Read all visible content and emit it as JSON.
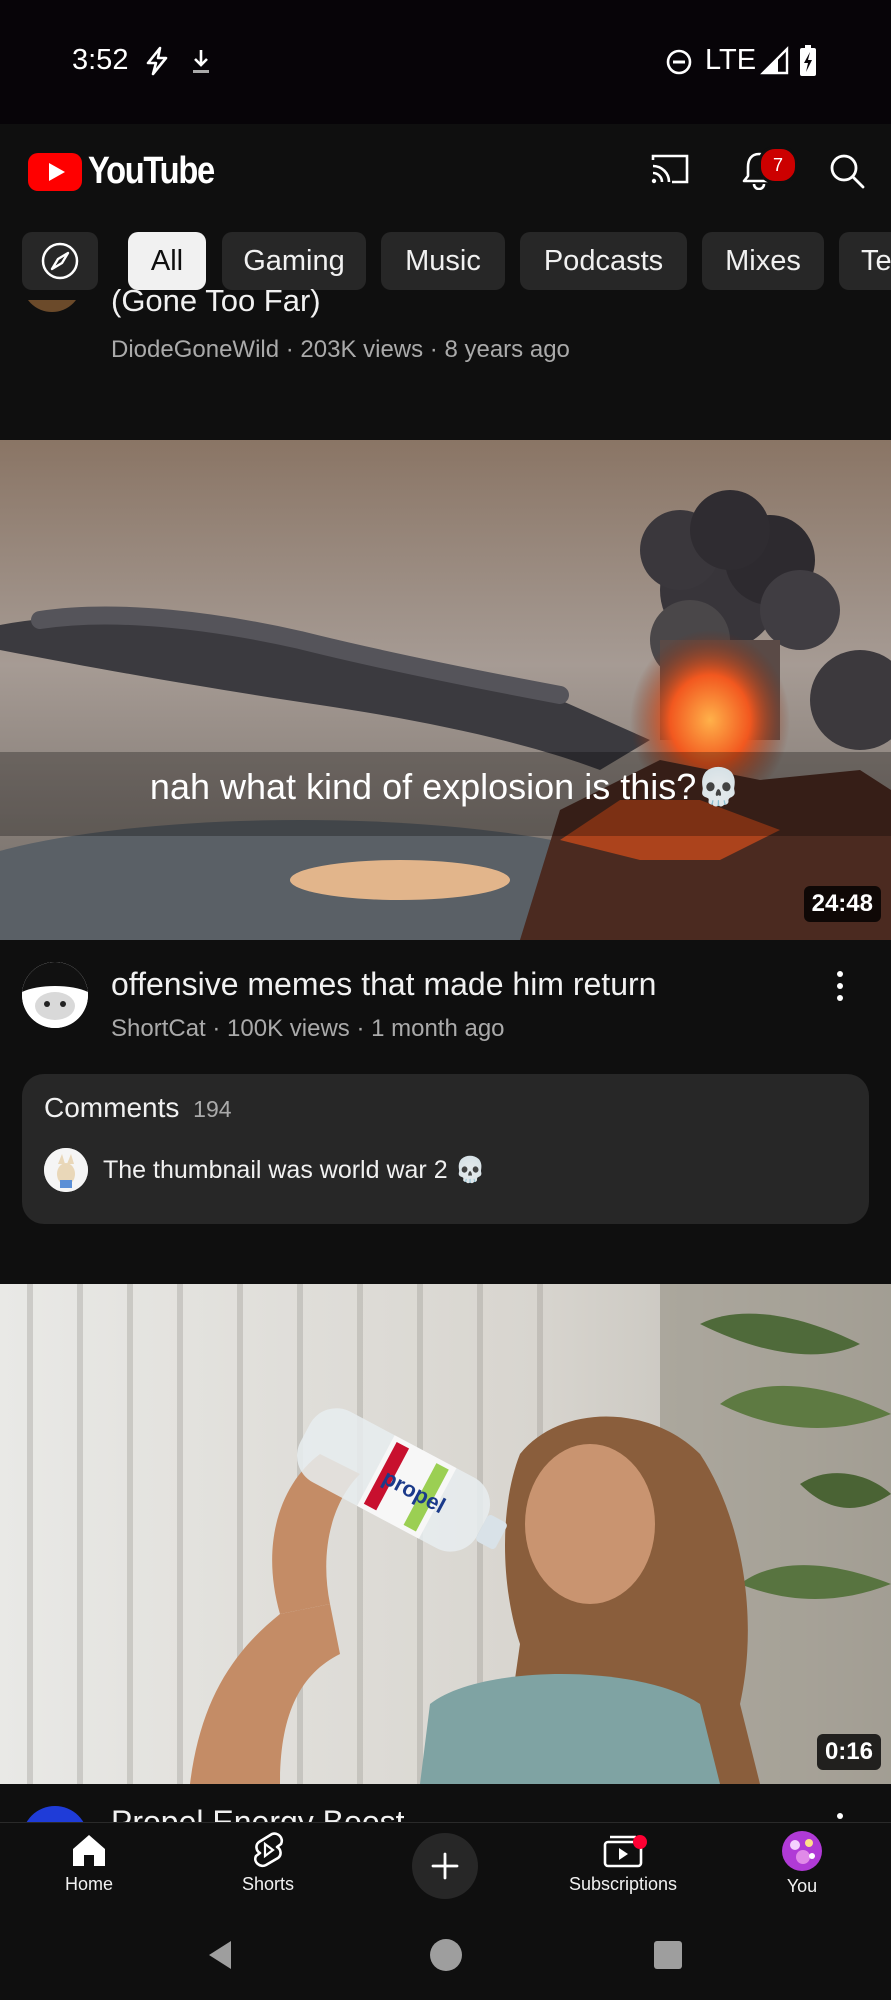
{
  "status_bar": {
    "time": "3:52",
    "network": "LTE",
    "icons": [
      "flash-icon",
      "download-icon",
      "dnd-icon",
      "signal-icon",
      "battery-charging-icon"
    ]
  },
  "app_bar": {
    "logo_text": "YouTube",
    "notification_count": "7",
    "brand_red": "#ff0000",
    "icons": [
      "cast-icon",
      "bell-icon",
      "search-icon"
    ]
  },
  "chips": {
    "explore_icon": "compass-icon",
    "items": [
      "All",
      "Gaming",
      "Music",
      "Podcasts",
      "Mixes",
      "Te"
    ],
    "active": "All"
  },
  "feed": {
    "video0": {
      "title_partial": "(Gone Too Far)",
      "meta": "DiodeGoneWild · 203K views · 8 years ago"
    },
    "video1": {
      "caption": "nah what kind of explosion is this?💀",
      "duration": "24:48",
      "title": "offensive memes that made him return",
      "meta": "ShortCat · 100K views · 1 month ago"
    },
    "comments": {
      "label": "Comments",
      "count": "194",
      "top_comment": "The thumbnail was world war 2 💀"
    },
    "video2": {
      "bottle_label": "propel",
      "duration": "0:16",
      "title_partial": "Propel Energy Boost"
    }
  },
  "bottom_nav": {
    "items": [
      {
        "label": "Home",
        "icon": "home-icon"
      },
      {
        "label": "Shorts",
        "icon": "shorts-icon"
      },
      {
        "label": "",
        "icon": "create-icon"
      },
      {
        "label": "Subscriptions",
        "icon": "subscriptions-icon"
      },
      {
        "label": "You",
        "icon": "avatar"
      }
    ]
  },
  "system_nav": {
    "icons": [
      "back-icon",
      "home-circle-icon",
      "recents-icon"
    ]
  }
}
